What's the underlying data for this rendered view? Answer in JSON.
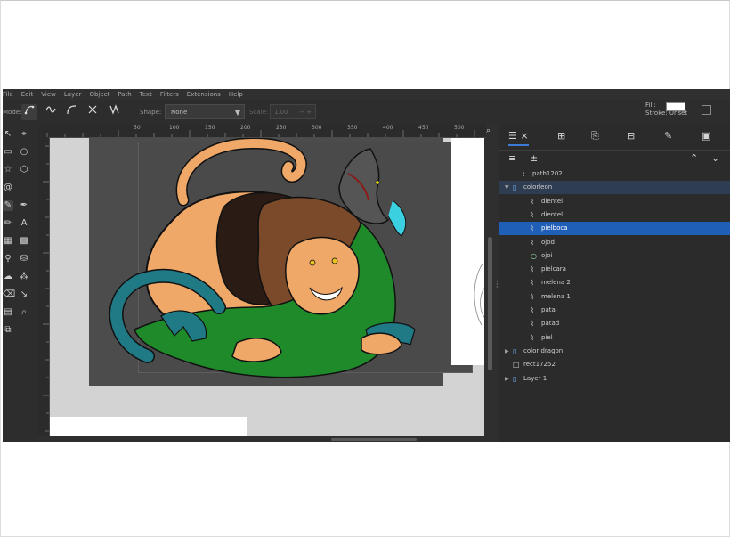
{
  "menu": [
    "File",
    "Edit",
    "View",
    "Layer",
    "Object",
    "Path",
    "Text",
    "Filters",
    "Extensions",
    "Help"
  ],
  "toolbar": {
    "mode_label": "Mode:",
    "shape_label": "Shape:",
    "shape_value": "None",
    "scale_label": "Scale:",
    "scale_value": "1.00",
    "fill_label": "Fill:",
    "stroke_label": "Stroke:",
    "stroke_value": "Unset",
    "fill_color": "#ffffff"
  },
  "ruler_ticks": [
    "50",
    "100",
    "150",
    "200",
    "250",
    "300",
    "350",
    "400",
    "450",
    "500"
  ],
  "layers_panel": {
    "rows": [
      {
        "label": "path1202",
        "icon": "path-icon",
        "indent": 1,
        "expander": ""
      },
      {
        "label": "colorleon",
        "icon": "group-icon",
        "indent": 0,
        "expander": "▼",
        "state": "group"
      },
      {
        "label": "dientel",
        "icon": "path-icon",
        "indent": 2,
        "expander": ""
      },
      {
        "label": "dientel",
        "icon": "path-icon",
        "indent": 2,
        "expander": ""
      },
      {
        "label": "pielboca",
        "icon": "path-icon",
        "indent": 2,
        "expander": "",
        "state": "selected"
      },
      {
        "label": "ojod",
        "icon": "path-icon",
        "indent": 2,
        "expander": ""
      },
      {
        "label": "ojoi",
        "icon": "circle-icon",
        "indent": 2,
        "expander": ""
      },
      {
        "label": "pielcara",
        "icon": "path-icon",
        "indent": 2,
        "expander": ""
      },
      {
        "label": "melena 2",
        "icon": "path-icon",
        "indent": 2,
        "expander": ""
      },
      {
        "label": "melena 1",
        "icon": "path-icon",
        "indent": 2,
        "expander": ""
      },
      {
        "label": "patai",
        "icon": "path-icon",
        "indent": 2,
        "expander": ""
      },
      {
        "label": "patad",
        "icon": "path-icon",
        "indent": 2,
        "expander": ""
      },
      {
        "label": "piel",
        "icon": "path-icon",
        "indent": 2,
        "expander": ""
      },
      {
        "label": "color dragon",
        "icon": "group-icon",
        "indent": 0,
        "expander": "▶"
      },
      {
        "label": "rect17252",
        "icon": "rect-icon",
        "indent": 0,
        "expander": ""
      },
      {
        "label": "Layer 1",
        "icon": "layer-icon",
        "indent": 0,
        "expander": "▶"
      }
    ]
  },
  "colors": {
    "selection": "#1f5fb8",
    "lion_skin": "#f0a868",
    "mane_dark": "#3a2a20",
    "mane_brown": "#7a4a2a",
    "dragon_green": "#1f8a2a",
    "dragon_teal": "#1f7a86",
    "accent_cyan": "#3ad0e0"
  }
}
